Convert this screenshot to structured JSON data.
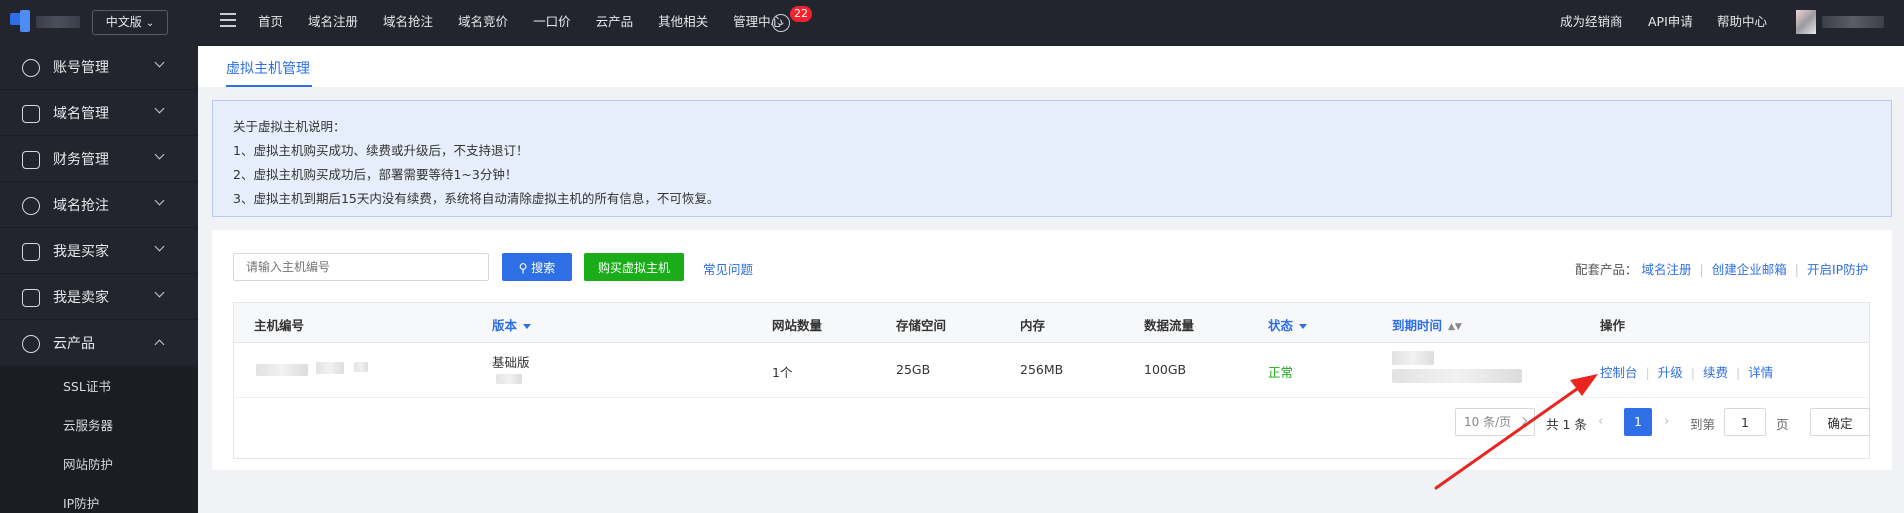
{
  "header": {
    "lang_label": "中文版",
    "nav": [
      "首页",
      "域名注册",
      "域名抢注",
      "域名竞价",
      "一口价",
      "云产品",
      "其他相关",
      "管理中心"
    ],
    "notification_count": "22",
    "right_links": [
      "成为经销商",
      "API申请",
      "帮助中心"
    ]
  },
  "sidebar": {
    "items": [
      {
        "label": "账号管理",
        "icon": "user-icon"
      },
      {
        "label": "域名管理",
        "icon": "layers-icon"
      },
      {
        "label": "财务管理",
        "icon": "wallet-icon"
      },
      {
        "label": "域名抢注",
        "icon": "clock-icon"
      },
      {
        "label": "我是买家",
        "icon": "cart-icon"
      },
      {
        "label": "我是卖家",
        "icon": "shop-icon"
      },
      {
        "label": "云产品",
        "icon": "cloud-icon"
      }
    ],
    "sub_items": [
      "SSL证书",
      "云服务器",
      "网站防护",
      "IP防护"
    ]
  },
  "main": {
    "tab": "虚拟主机管理",
    "notice": [
      "关于虚拟主机说明：",
      "1、虚拟主机购买成功、续费或升级后，不支持退订！",
      "2、虚拟主机购买成功后，部署需要等待1~3分钟！",
      "3、虚拟主机到期后15天内没有续费，系统将自动清除虚拟主机的所有信息，不可恢复。"
    ],
    "toolbar": {
      "search_placeholder": "请输入主机编号",
      "search_label": "搜索",
      "buy_label": "购买虚拟主机",
      "faq_label": "常见问题",
      "addons_label": "配套产品：",
      "addons": [
        "域名注册",
        "创建企业邮箱",
        "开启IP防护"
      ]
    },
    "table": {
      "headers": [
        "主机编号",
        "版本",
        "网站数量",
        "存储空间",
        "内存",
        "数据流量",
        "状态",
        "到期时间",
        "操作"
      ],
      "rows": [
        {
          "version": "基础版",
          "site_count": "1个",
          "storage": "25GB",
          "memory": "256MB",
          "traffic": "100GB",
          "status": "正常",
          "actions": [
            "控制台",
            "升级",
            "续费",
            "详情"
          ]
        }
      ]
    },
    "pagination": {
      "page_size": "10 条/页",
      "total": "共 1 条",
      "current": "1",
      "goto_label": "到第",
      "goto_value": "1",
      "page_unit": "页",
      "confirm_label": "确定"
    }
  },
  "colors": {
    "primary": "#2f6fe6",
    "success": "#1aad19",
    "annotation": "#e8251f",
    "topbar_bg": "#22252d"
  }
}
